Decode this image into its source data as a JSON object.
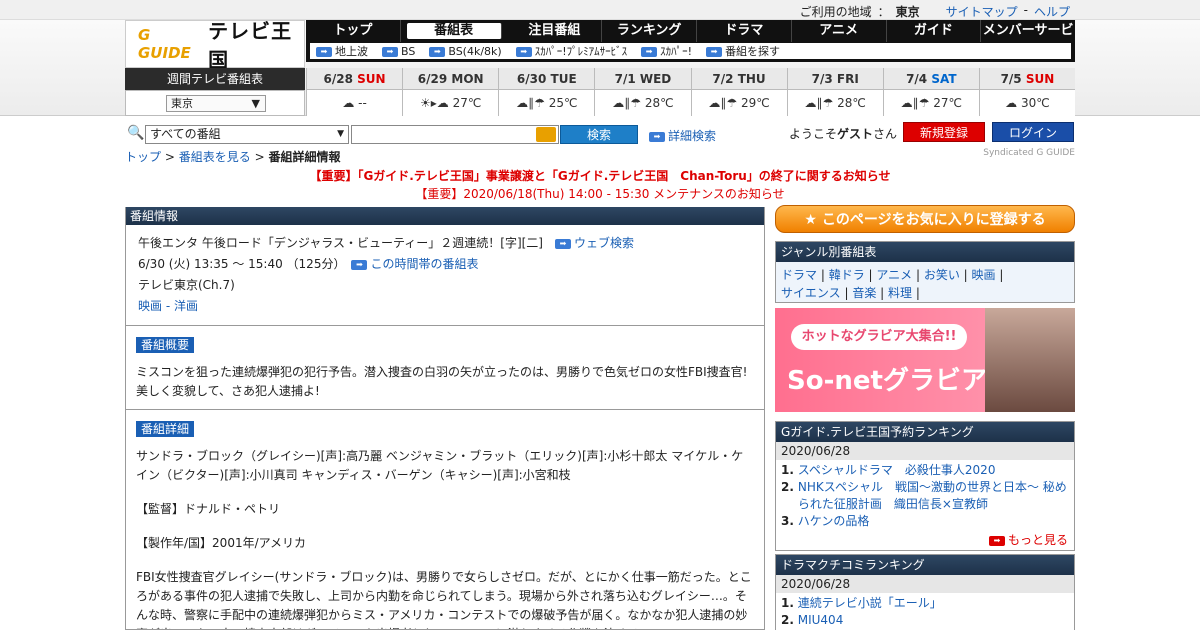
{
  "topbar": {
    "region_label": "ご利用の地域",
    "sep": "：",
    "region": "東京",
    "sitemap": "サイトマップ",
    "dash": "-",
    "help": "ヘルプ"
  },
  "logo": {
    "g": "G GUIDE",
    "title": "テレビ王国"
  },
  "nav": {
    "main": [
      "トップ",
      "番組表",
      "注目番組",
      "ランキング",
      "ドラマ",
      "アニメ",
      "ガイド",
      "メンバーサービス"
    ],
    "sub": [
      "地上波",
      "BS",
      "BS(4k/8k)",
      "ｽｶﾊﾟｰ!ﾌﾟﾚﾐｱﾑｻｰﾋﾞｽ",
      "ｽｶﾊﾟｰ!",
      "番組を探す"
    ]
  },
  "week": {
    "label": "週間テレビ番組表",
    "area": "東京"
  },
  "days": [
    {
      "date": "6/28",
      "dow": "SUN",
      "kind": "sun",
      "weather": "☁ --"
    },
    {
      "date": "6/29",
      "dow": "MON",
      "kind": "",
      "weather": "☀▸☁ 27℃"
    },
    {
      "date": "6/30",
      "dow": "TUE",
      "kind": "",
      "weather": "☁∥☂ 25℃"
    },
    {
      "date": "7/1",
      "dow": "WED",
      "kind": "",
      "weather": "☁∥☂ 28℃"
    },
    {
      "date": "7/2",
      "dow": "THU",
      "kind": "",
      "weather": "☁∥☂ 29℃"
    },
    {
      "date": "7/3",
      "dow": "FRI",
      "kind": "",
      "weather": "☁∥☂ 28℃"
    },
    {
      "date": "7/4",
      "dow": "SAT",
      "kind": "sat",
      "weather": "☁∥☂ 27℃"
    },
    {
      "date": "7/5",
      "dow": "SUN",
      "kind": "sun",
      "weather": "☁ 30℃"
    }
  ],
  "search": {
    "category": "すべての番組",
    "button": "検索",
    "advanced": "詳細検索"
  },
  "user": {
    "welcome_pre": "ようこそ",
    "guest": "ゲスト",
    "welcome_post": "さん",
    "register": "新規登録",
    "login": "ログイン"
  },
  "breadcrumb": {
    "top": "トップ",
    "sep": ">",
    "list": "番組表を見る",
    "current": "番組詳細情報"
  },
  "syndicated": "Syndicated G GUIDE",
  "notices": [
    "【重要】「Gガイド.テレビ王国」事業譲渡と「Gガイド.テレビ王国　Chan-Toru」の終了に関するお知らせ",
    "【重要】2020/06/18(Thu) 14:00 - 15:30 メンテナンスのお知らせ"
  ],
  "program": {
    "header": "番組情報",
    "title": "午後エンタ 午後ロード「デンジャラス・ビューティー」２週連続！[字][二]",
    "web_search": "ウェブ検索",
    "time": "6/30 (火) 13:35 ～ 15:40 （125分）",
    "timeslot_link": "この時間帯の番組表",
    "channel": "テレビ東京(Ch.7)",
    "genre": "映画 - 洋画",
    "summary_tag": "番組概要",
    "summary": "ミスコンを狙った連続爆弾犯の犯行予告。潜入捜査の白羽の矢が立ったのは、男勝りで色気ゼロの女性FBI捜査官! 美しく変貌して、さあ犯人逮捕よ!",
    "detail_tag": "番組詳細",
    "cast": "サンドラ・ブロック（グレイシー)[声]:高乃麗 ベンジャミン・ブラット（エリック)[声]:小杉十郎太 マイケル・ケイン（ビクター)[声]:小川真司 キャンディス・バーゲン（キャシー)[声]:小宮和枝",
    "director": "【監督】ドナルド・ペトリ",
    "year": "【製作年/国】2001年/アメリカ",
    "story": "FBI女性捜査官グレイシー(サンドラ・ブロック)は、男勝りで女らしさゼロ。だが、とにかく仕事一筋だった。ところがある事件の犯人逮捕で失敗し、上司から内勤を命じられてしまう。現場から外され落ち込むグレイシー…。そんな時、警察に手配中の連続爆弾犯からミス・アメリカ・コンテストでの爆破予告が届く。なかなか犯人逮捕の妙案が出てこない中、捜査本部はグレイシーを出場者としてミスコンに潜入させる作戦を決める。"
  },
  "sidebar": {
    "favorite": "★ このページをお気に入りに登録する",
    "genre_header": "ジャンル別番組表",
    "genres": [
      "ドラマ",
      "韓ドラ",
      "アニメ",
      "お笑い",
      "映画",
      "サイエンス",
      "音楽",
      "料理"
    ],
    "banner_pill": "ホットなグラビア大集合!!",
    "banner_title": "So-netグラビア",
    "ranking_header": "Gガイド.テレビ王国予約ランキング",
    "ranking_date": "2020/06/28",
    "ranking": [
      "スペシャルドラマ　必殺仕事人2020",
      "NHKスペシャル　戦国〜激動の世界と日本〜 秘められた征服計画　織田信長×宣教師",
      "ハケンの品格"
    ],
    "more": "もっと見る",
    "drama_header": "ドラマクチコミランキング",
    "drama_date": "2020/06/28",
    "drama": [
      "連続テレビ小説「エール」",
      "MIU404"
    ]
  }
}
